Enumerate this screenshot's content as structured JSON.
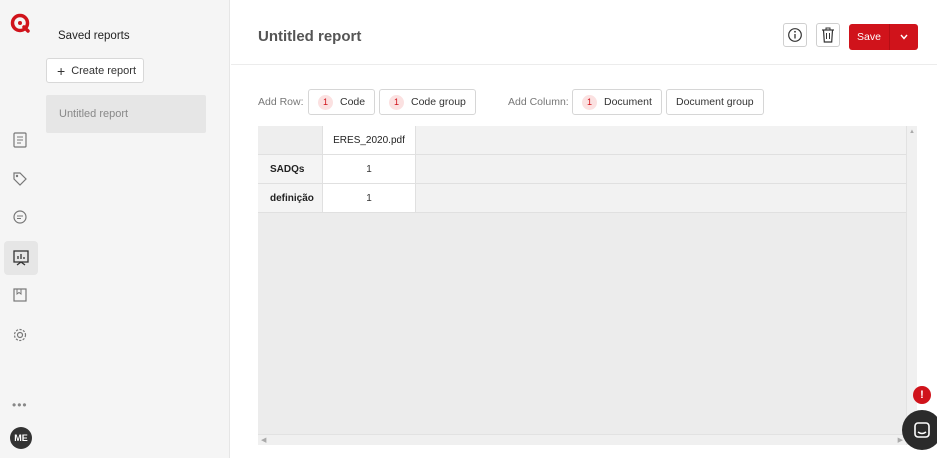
{
  "app": {
    "avatar_initials": "ME",
    "more_label": "•••",
    "brand_color": "#d0131b"
  },
  "sidebar": {
    "title": "Saved reports",
    "create_label": "Create report",
    "reports": [
      "Untitled report"
    ]
  },
  "header": {
    "title": "Untitled report",
    "save_label": "Save"
  },
  "toolbar": {
    "add_row_label": "Add Row:",
    "add_column_label": "Add Column:",
    "row_chips": [
      {
        "count": "1",
        "label": "Code"
      },
      {
        "count": "1",
        "label": "Code group"
      }
    ],
    "column_chips": [
      {
        "count": "1",
        "label": "Document"
      },
      {
        "count": "",
        "label": "Document group"
      }
    ]
  },
  "table": {
    "columns": [
      "ERES_2020.pdf"
    ],
    "rows": [
      {
        "label": "SADQs",
        "values": [
          "1"
        ]
      },
      {
        "label": "definição",
        "values": [
          "1"
        ]
      }
    ]
  },
  "widgets": {
    "alert_label": "!"
  }
}
